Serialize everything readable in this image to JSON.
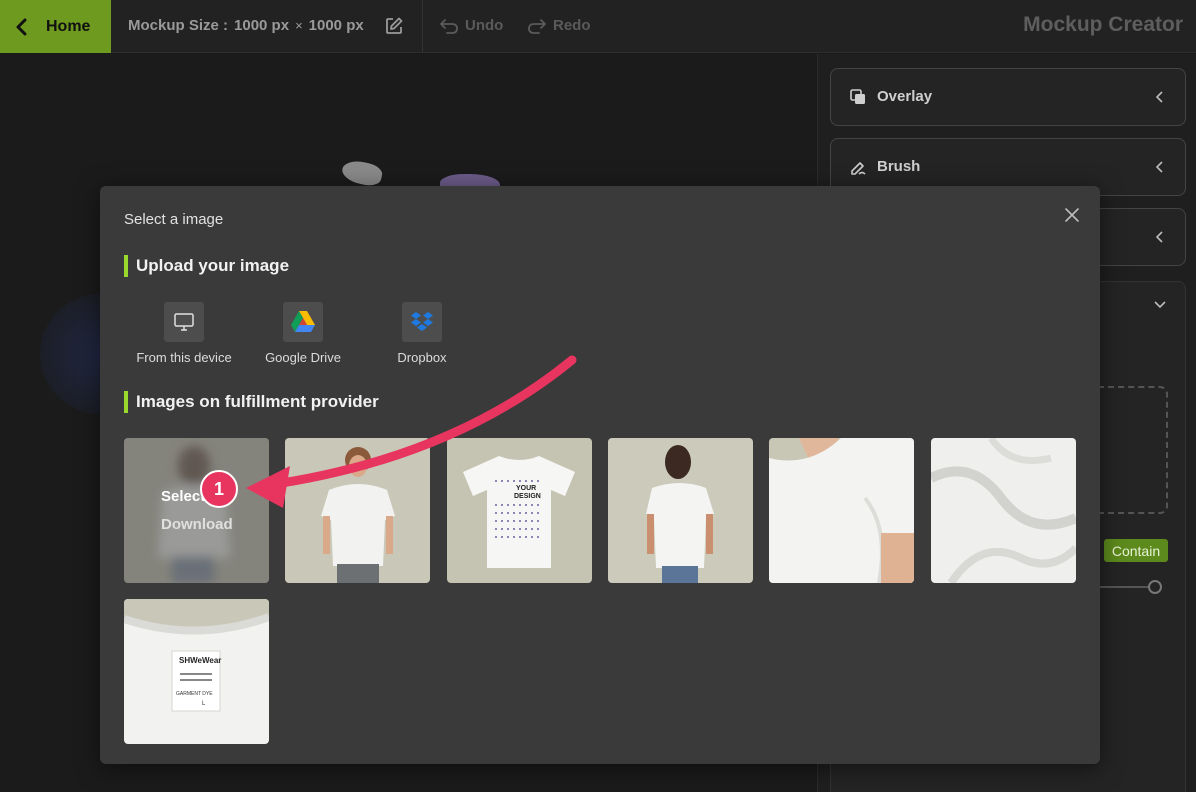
{
  "topbar": {
    "home_label": "Home",
    "mockup_size_label": "Mockup Size :",
    "mockup_width": "1000 px",
    "times": "×",
    "mockup_height": "1000 px",
    "undo_label": "Undo",
    "redo_label": "Redo",
    "app_title": "Mockup Creator"
  },
  "right_panel": {
    "cards": [
      {
        "label": "Overlay",
        "icon": "overlay-icon"
      },
      {
        "label": "Brush",
        "icon": "brush-icon"
      }
    ],
    "contain_label": "Contain"
  },
  "modal": {
    "title": "Select a image",
    "upload_heading": "Upload your image",
    "sources": [
      {
        "label": "From this device",
        "icon": "monitor-icon"
      },
      {
        "label": "Google Drive",
        "icon": "google-drive-icon"
      },
      {
        "label": "Dropbox",
        "icon": "dropbox-icon"
      }
    ],
    "provider_heading": "Images on fulfillment provider",
    "thumb_overlay": {
      "select_label": "Select",
      "download_label": "Download"
    },
    "tshirt_print_text": [
      "YOUR",
      "DESIGN"
    ],
    "tag_text": [
      "SHWeWear",
      "GARMENT DYE"
    ],
    "tag_size": "L"
  },
  "annotation": {
    "step_number": "1",
    "arrow_color": "#e8355f"
  },
  "colors": {
    "accent": "#6d9a1f",
    "accent_bar": "#9bd82e",
    "annotation": "#e8355f"
  }
}
